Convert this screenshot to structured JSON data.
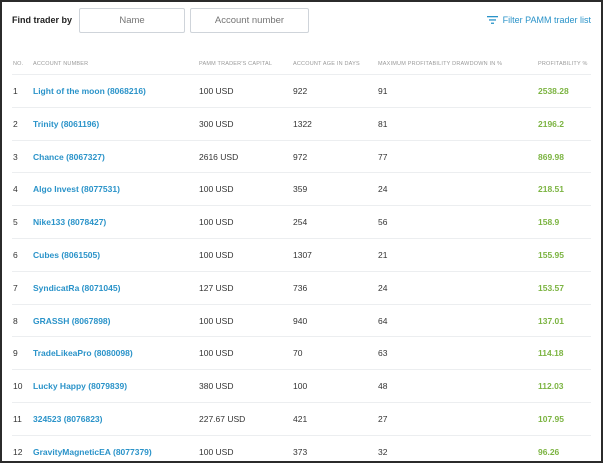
{
  "search": {
    "label": "Find trader by",
    "name_placeholder": "Name",
    "account_placeholder": "Account number"
  },
  "filter": {
    "label": "Filter PAMM trader list",
    "icon": "filter-lines-icon"
  },
  "columns": {
    "no": "NO.",
    "account": "ACCOUNT NUMBER",
    "capital": "PAMM TRADER'S CAPITAL",
    "age": "ACCOUNT AGE IN DAYS",
    "drawdown": "MAXIMUM PROFITABILITY DRAWDOWN IN %",
    "profitability": "PROFITABILITY %"
  },
  "rows": [
    {
      "no": "1",
      "account": "Light of the moon (8068216)",
      "capital": "100 USD",
      "age": "922",
      "drawdown": "91",
      "profitability": "2538.28"
    },
    {
      "no": "2",
      "account": "Trinity (8061196)",
      "capital": "300 USD",
      "age": "1322",
      "drawdown": "81",
      "profitability": "2196.2"
    },
    {
      "no": "3",
      "account": "Chance (8067327)",
      "capital": "2616 USD",
      "age": "972",
      "drawdown": "77",
      "profitability": "869.98"
    },
    {
      "no": "4",
      "account": "Algo Invest (8077531)",
      "capital": "100 USD",
      "age": "359",
      "drawdown": "24",
      "profitability": "218.51"
    },
    {
      "no": "5",
      "account": "Nike133 (8078427)",
      "capital": "100 USD",
      "age": "254",
      "drawdown": "56",
      "profitability": "158.9"
    },
    {
      "no": "6",
      "account": "Cubes (8061505)",
      "capital": "100 USD",
      "age": "1307",
      "drawdown": "21",
      "profitability": "155.95"
    },
    {
      "no": "7",
      "account": "SyndicatRa (8071045)",
      "capital": "127 USD",
      "age": "736",
      "drawdown": "24",
      "profitability": "153.57"
    },
    {
      "no": "8",
      "account": "GRASSH (8067898)",
      "capital": "100 USD",
      "age": "940",
      "drawdown": "64",
      "profitability": "137.01"
    },
    {
      "no": "9",
      "account": "TradeLikeaPro (8080098)",
      "capital": "100 USD",
      "age": "70",
      "drawdown": "63",
      "profitability": "114.18"
    },
    {
      "no": "10",
      "account": "Lucky Happy (8079839)",
      "capital": "380 USD",
      "age": "100",
      "drawdown": "48",
      "profitability": "112.03"
    },
    {
      "no": "11",
      "account": "324523 (8076823)",
      "capital": "227.67 USD",
      "age": "421",
      "drawdown": "27",
      "profitability": "107.95"
    },
    {
      "no": "12",
      "account": "GravityMagneticEA (8077379)",
      "capital": "100 USD",
      "age": "373",
      "drawdown": "32",
      "profitability": "96.26"
    }
  ],
  "colors": {
    "link": "#2a93c9",
    "profit": "#7cb442",
    "header_text": "#9a9a9a"
  }
}
